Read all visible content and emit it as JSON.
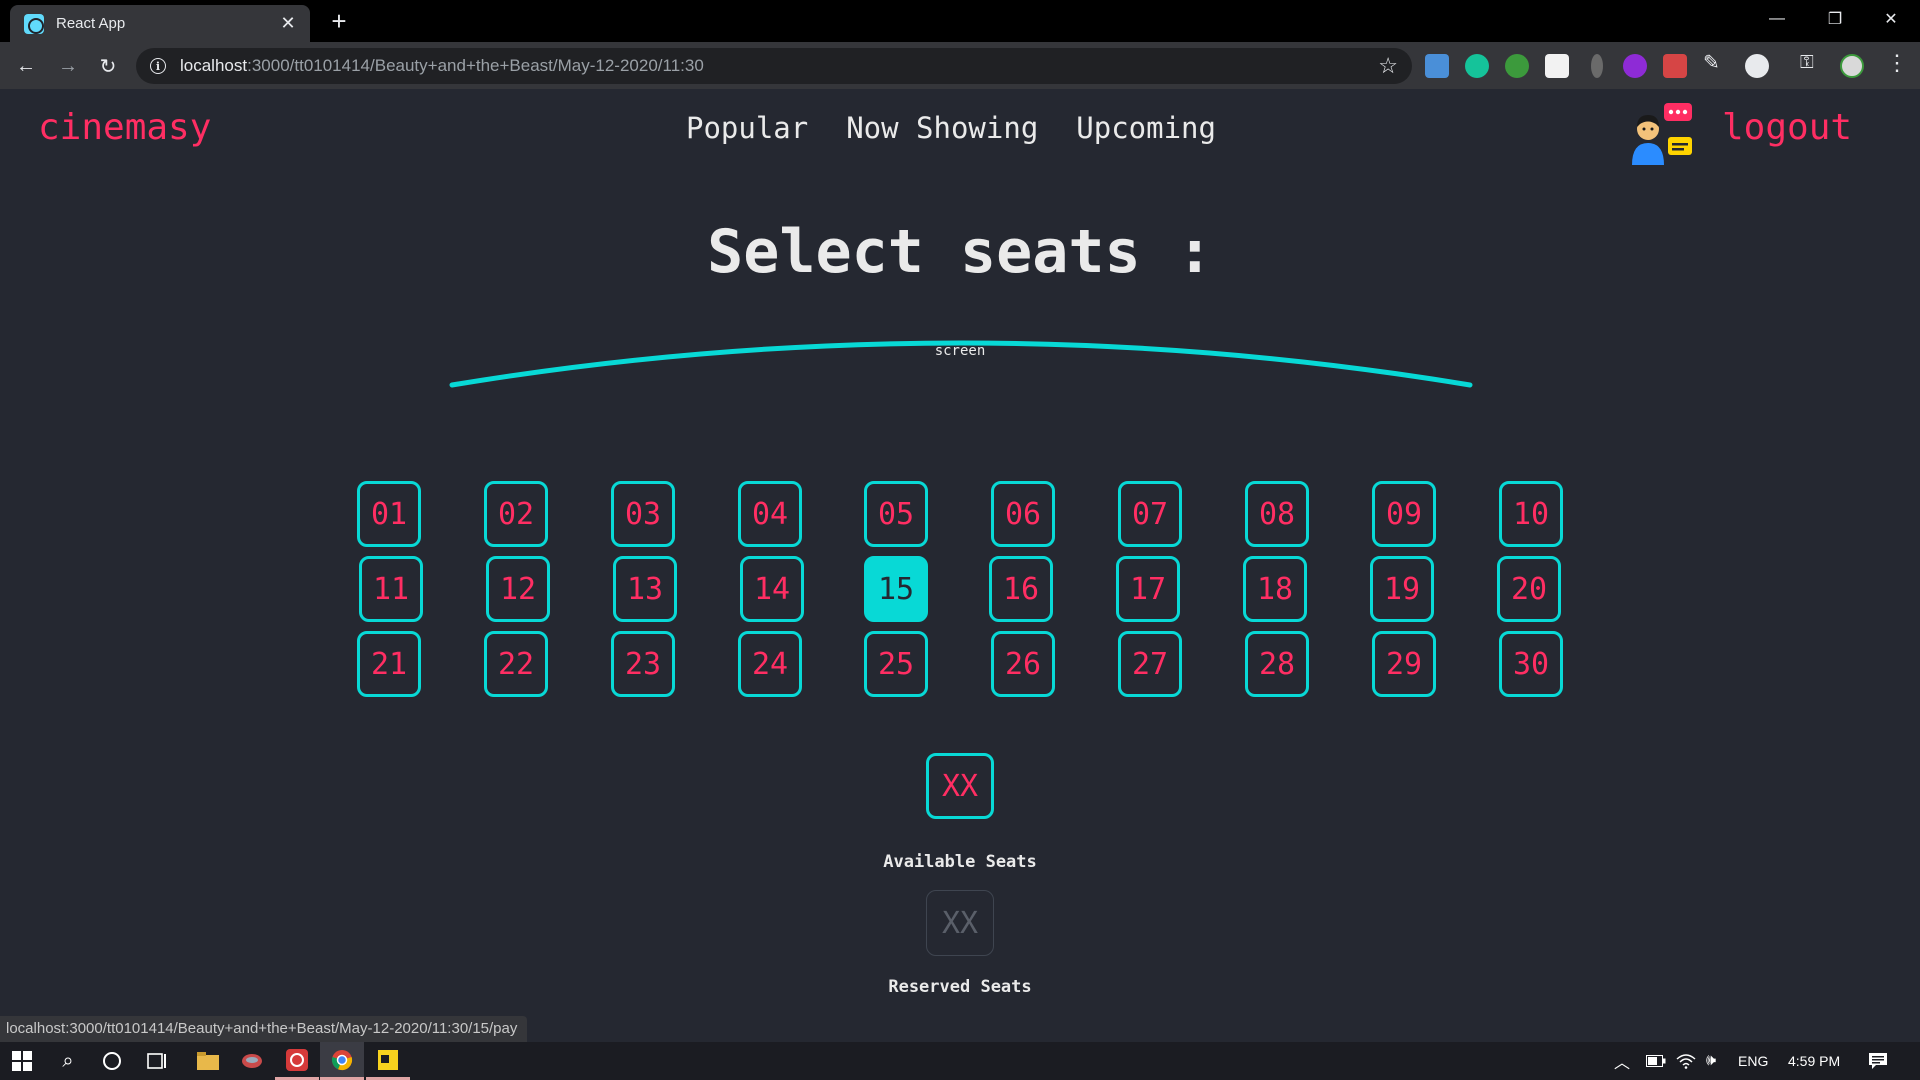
{
  "browser": {
    "tab_title": "React App",
    "url_host": "localhost",
    "url_path": ":3000/tt0101414/Beauty+and+the+Beast/May-12-2020/11:30",
    "status_url": "localhost:3000/tt0101414/Beauty+and+the+Beast/May-12-2020/11:30/15/pay"
  },
  "header": {
    "brand": "cinemasy",
    "nav": [
      "Popular",
      "Now Showing",
      "Upcoming"
    ],
    "logout": "logout"
  },
  "main": {
    "title": "Select seats :",
    "screen_label": "screen",
    "seat_rows": [
      [
        "01",
        "02",
        "03",
        "04",
        "05",
        "06",
        "07",
        "08",
        "09",
        "10"
      ],
      [
        "11",
        "12",
        "13",
        "14",
        "15",
        "16",
        "17",
        "18",
        "19",
        "20"
      ],
      [
        "21",
        "22",
        "23",
        "24",
        "25",
        "26",
        "27",
        "28",
        "29",
        "30"
      ]
    ],
    "selected_seat": "15",
    "legend": {
      "available_sample": "XX",
      "available_label": "Available Seats",
      "reserved_sample": "XX",
      "reserved_label": "Reserved Seats"
    }
  },
  "taskbar": {
    "lang": "ENG",
    "time": "4:59 PM"
  },
  "colors": {
    "background": "#252831",
    "accent_pink": "#ff2e63",
    "accent_cyan": "#08d9d6",
    "text": "#eaeaea"
  }
}
